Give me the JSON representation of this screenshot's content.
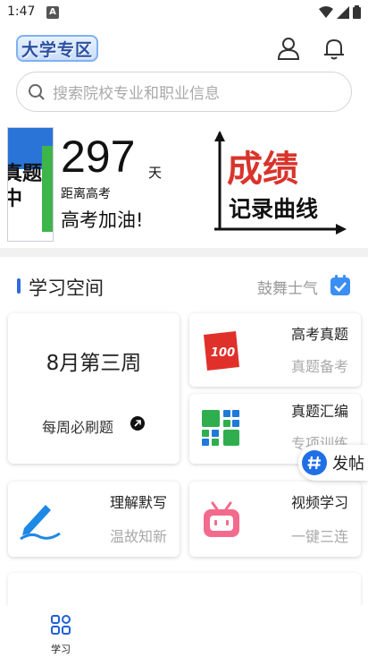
{
  "status_bar": {
    "time": "1:47",
    "notification_badge": "A"
  },
  "header": {
    "logo_text": "大学专区"
  },
  "search": {
    "placeholder": "搜索院校专业和职业信息"
  },
  "banner": {
    "book_text": "真题中",
    "days_number": "297",
    "days_unit": "天",
    "days_label": "距离高考",
    "cheer": "高考加油!",
    "chart_title_line1": "成绩",
    "chart_title_line2": "记录曲线"
  },
  "section": {
    "title": "学习空间",
    "right_label": "鼓舞士气"
  },
  "cards": {
    "week": {
      "title": "8月第三周",
      "subtitle": "每周必刷题"
    },
    "exam": {
      "title": "高考真题",
      "subtitle": "真题备考",
      "icon_text": "100"
    },
    "collect": {
      "title": "真题汇编",
      "subtitle": "专项训练"
    },
    "recite": {
      "title": "理解默写",
      "subtitle": "温故知新"
    },
    "video": {
      "title": "视频学习",
      "subtitle": "一键三连"
    }
  },
  "post_button": {
    "label": "发帖"
  },
  "tabbar": {
    "study_label": "学习"
  },
  "colors": {
    "accent": "#2f6be0",
    "red": "#e0302a",
    "green": "#2fae4f",
    "pink": "#f36b8c",
    "blue_icon": "#1f7ad8"
  }
}
